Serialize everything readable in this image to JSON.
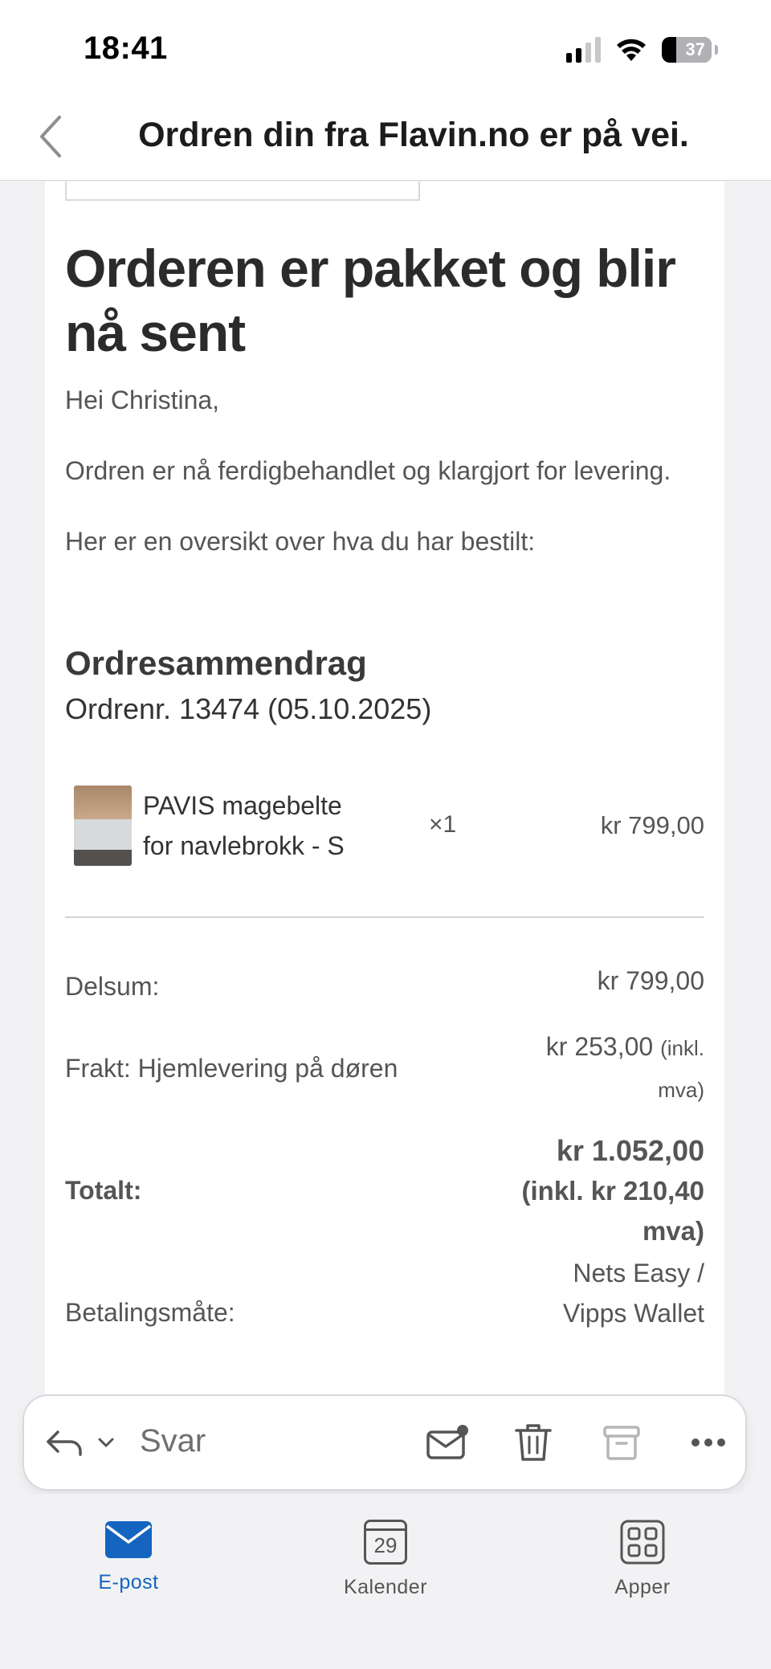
{
  "status_bar": {
    "time": "18:41",
    "battery_percent": "37",
    "signal_bars_active": 2,
    "signal_bars_total": 4
  },
  "header": {
    "title": "Ordren din fra Flavin.no er på vei."
  },
  "email": {
    "headline": "Orderen er pakket og blir nå sent",
    "greeting": "Hei Christina,",
    "paragraph_1": "Ordren er nå ferdigbehandlet og klargjort for levering.",
    "paragraph_2": "Her er en oversikt over hva du har bestilt:",
    "summary_title": "Ordresammendrag",
    "order_number": "Ordrenr. 13474 (05.10.2025)",
    "items": [
      {
        "name": "PAVIS magebelte for navlebrokk - S",
        "quantity": "×1",
        "price": "kr 799,00"
      }
    ],
    "totals": {
      "subtotal_label": "Delsum:",
      "subtotal_value": "kr 799,00",
      "shipping_label": "Frakt: Hjemlevering på døren",
      "shipping_value": "kr 253,00",
      "shipping_note": "(inkl. mva)",
      "total_label": "Totalt:",
      "total_value": "kr 1.052,00",
      "total_note": "(inkl. kr 210,40 mva)",
      "payment_label": "Betalingsmåte:",
      "payment_value": "Nets Easy / Vipps Wallet"
    }
  },
  "reply_bar": {
    "reply_label": "Svar"
  },
  "tabbar": {
    "tabs": [
      {
        "label": "E-post",
        "icon": "mail-icon",
        "active": true
      },
      {
        "label": "Kalender",
        "icon": "calendar-icon",
        "day": "29",
        "active": false
      },
      {
        "label": "Apper",
        "icon": "apps-grid-icon",
        "active": false
      }
    ]
  },
  "colors": {
    "accent": "#1565c0",
    "background": "#f2f2f4",
    "card": "#ffffff",
    "text_muted": "#555555"
  }
}
